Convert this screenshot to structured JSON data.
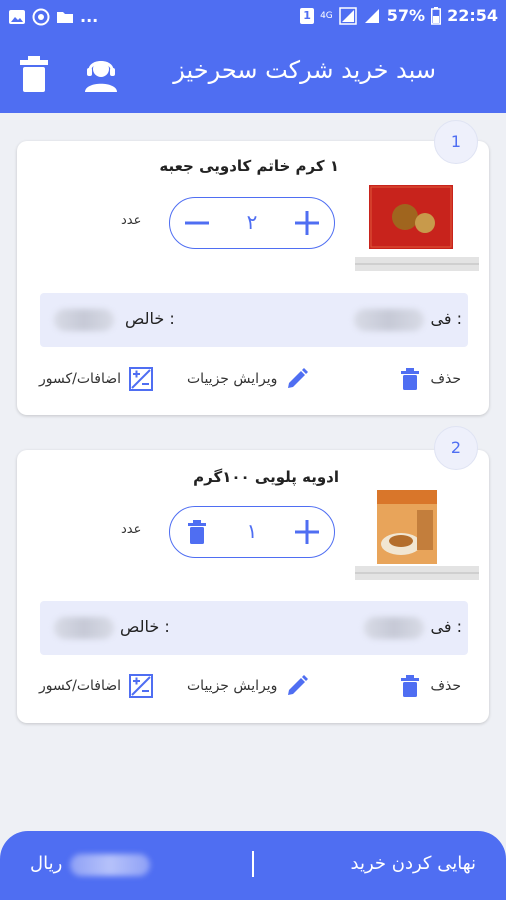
{
  "statusbar": {
    "left_more": "...",
    "sim_badge": "1",
    "network": "4G",
    "battery": "57%",
    "time": "22:54"
  },
  "header": {
    "title": "سبد خرید شرکت سحرخیز"
  },
  "items": [
    {
      "index": "1",
      "title": "۱ کرم خاتم کادویی جعبه",
      "quantity": "۲",
      "unit": "عدد",
      "unit_price_label": "فی :",
      "net_label": "خالص :",
      "delete_label": "حذف",
      "edit_label": "ویرایش جزییات",
      "extras_label": "اضافات/کسور"
    },
    {
      "index": "2",
      "title": "ادویه پلویی ۱۰۰گرم",
      "quantity": "۱",
      "unit": "عدد",
      "unit_price_label": "فی :",
      "net_label": "خالص :",
      "delete_label": "حذف",
      "edit_label": "ویرایش جزییات",
      "extras_label": "اضافات/کسور"
    }
  ],
  "footer": {
    "finalize_label": "نهایی کردن خرید",
    "divider": "|",
    "currency": "ریال"
  },
  "colors": {
    "primary": "#4f6ef2",
    "price_row_bg": "#e9ecfb",
    "background": "#eef0f5"
  }
}
